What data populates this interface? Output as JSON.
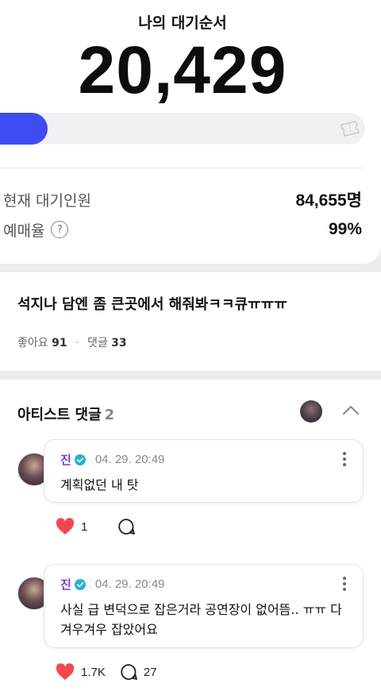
{
  "queue": {
    "title": "나의 대기순서",
    "number": "20,429",
    "progress_fraction": 0.13,
    "current_waiting_label": "현재 대기인원",
    "current_waiting_value": "84,655명",
    "ticket_rate_label": "예매율",
    "ticket_rate_help": "?",
    "ticket_rate_value": "99%"
  },
  "post": {
    "text": "석지나 담엔 좀 큰곳에서 해줘봐ㅋㅋ큐ㅠㅠㅠ",
    "likes_label": "좋아요",
    "likes_count": "91",
    "separator": "·",
    "comments_label": "댓글",
    "comments_count": "33"
  },
  "artist_comments": {
    "header": "아티스트 댓글",
    "count": "2",
    "items": [
      {
        "author": "진",
        "timestamp": "04. 29. 20:49",
        "text": "계획없던 내 탓",
        "likes": "1",
        "replies": ""
      },
      {
        "author": "진",
        "timestamp": "04. 29. 20:49",
        "text": "사실 급 변덕으로 잡은거라 공연장이 없어뜸.. ㅠㅠ 다 겨우겨우 잡았어요",
        "likes": "1.7K",
        "replies": "27"
      }
    ]
  },
  "colors": {
    "accent_blue": "#3f4cf2",
    "author_purple": "#7a3dc6",
    "heart_red": "#f2474f",
    "verified_teal": "#23b5c8"
  },
  "icons": [
    "ticket-icon",
    "help-icon",
    "chevron-up-icon",
    "verified-icon",
    "more-icon",
    "heart-icon",
    "reply-icon"
  ]
}
